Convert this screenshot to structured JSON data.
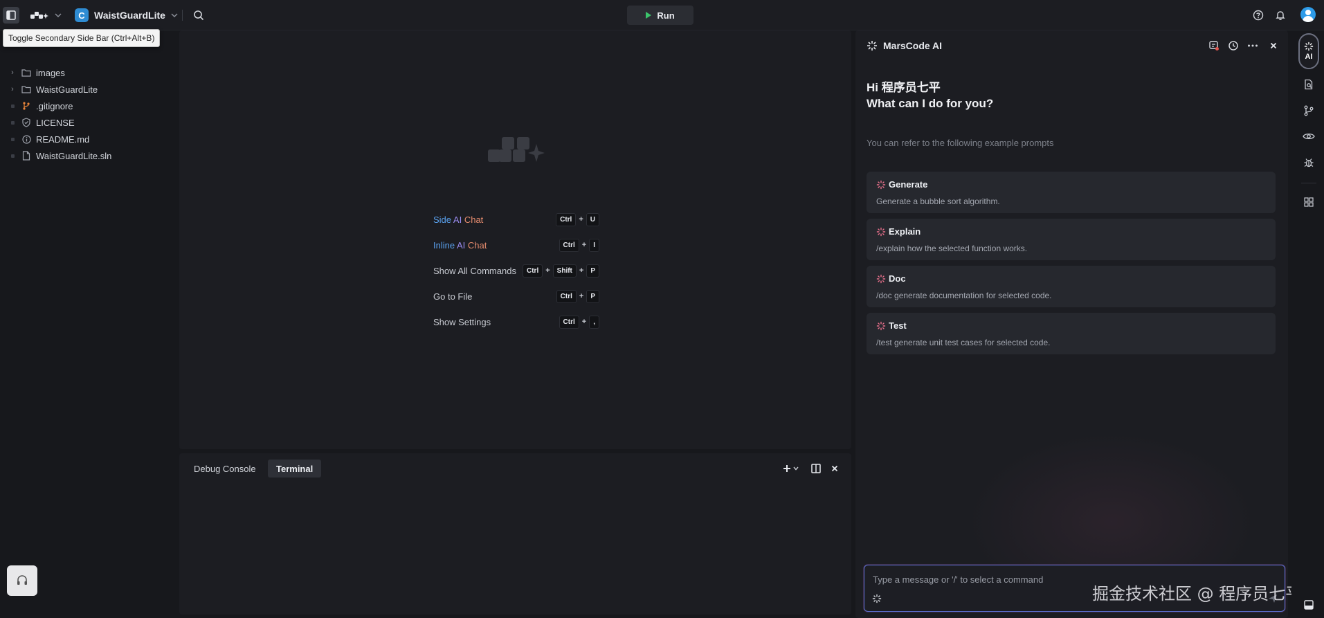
{
  "titlebar": {
    "project_name": "WaistGuardLite",
    "project_initial": "C",
    "run_label": "Run"
  },
  "tooltip": {
    "text": "Toggle Secondary Side Bar (Ctrl+Alt+B)"
  },
  "explorer": {
    "items": [
      {
        "label": "images",
        "kind": "folder"
      },
      {
        "label": "WaistGuardLite",
        "kind": "folder"
      },
      {
        "label": ".gitignore",
        "kind": "git"
      },
      {
        "label": "LICENSE",
        "kind": "license"
      },
      {
        "label": "README.md",
        "kind": "readme"
      },
      {
        "label": "WaistGuardLite.sln",
        "kind": "file"
      }
    ]
  },
  "editor": {
    "shortcuts": [
      {
        "label_parts": [
          "Side",
          " AI",
          " Chat"
        ],
        "keys": [
          "Ctrl",
          "U"
        ]
      },
      {
        "label_parts": [
          "Inline",
          " AI",
          " Chat"
        ],
        "keys": [
          "Ctrl",
          "I"
        ]
      },
      {
        "label": "Show All Commands",
        "keys": [
          "Ctrl",
          "Shift",
          "P"
        ]
      },
      {
        "label": "Go to File",
        "keys": [
          "Ctrl",
          "P"
        ]
      },
      {
        "label": "Show Settings",
        "keys": [
          "Ctrl",
          ","
        ]
      }
    ]
  },
  "panel": {
    "tabs": [
      {
        "label": "Debug Console",
        "active": false
      },
      {
        "label": "Terminal",
        "active": true
      }
    ]
  },
  "ai": {
    "title": "MarsCode AI",
    "greeting_line1": "Hi 程序员七平",
    "greeting_line2": "What can I do for you?",
    "hint": "You can refer to the following example prompts",
    "prompts": [
      {
        "title": "Generate",
        "desc": "Generate a bubble sort algorithm."
      },
      {
        "title": "Explain",
        "desc": "/explain how the selected function works."
      },
      {
        "title": "Doc",
        "desc": "/doc generate documentation for selected code."
      },
      {
        "title": "Test",
        "desc": "/test generate unit test cases for selected code."
      }
    ],
    "input_placeholder": "Type a message or '/' to select a command"
  },
  "activity": {
    "ai_label": "AI"
  },
  "watermark": "掘金技术社区 @ 程序员七平",
  "colors": {
    "accent_blue": "#2f8cd3",
    "run_green": "#3bc46b",
    "input_border": "#5b6fd1"
  }
}
